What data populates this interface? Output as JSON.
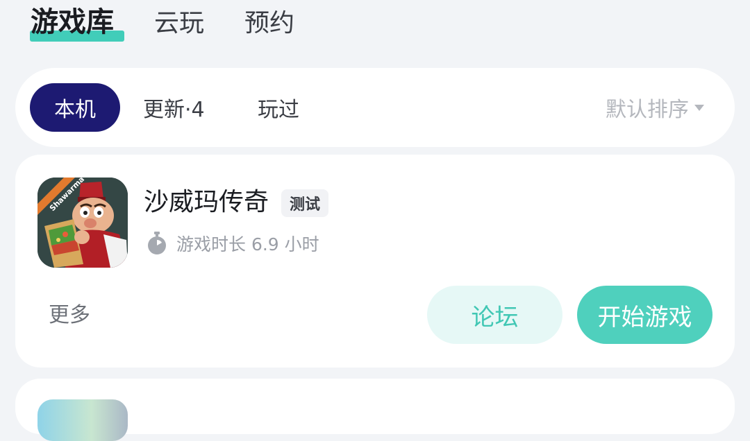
{
  "top_tabs": [
    {
      "label": "游戏库",
      "active": true
    },
    {
      "label": "云玩",
      "active": false
    },
    {
      "label": "预约",
      "active": false
    }
  ],
  "filter": {
    "tabs": [
      {
        "label": "本机",
        "active": true
      },
      {
        "label": "更新·4",
        "active": false
      },
      {
        "label": "玩过",
        "active": false
      }
    ],
    "sort_label": "默认排序",
    "sort_icon": "caret-down-icon"
  },
  "games": [
    {
      "name": "沙威玛传奇",
      "badge": "测试",
      "icon_text": "Shawarma",
      "playtime": "游戏时长 6.9 小时",
      "more_label": "更多",
      "forum_label": "论坛",
      "play_label": "开始游戏"
    }
  ],
  "colors": {
    "accent": "#41cdb9",
    "active_pill": "#1d1a72",
    "play_button": "#4fd0bd",
    "forum_button_bg": "#e6f8f6",
    "background": "#f2f4f7"
  }
}
